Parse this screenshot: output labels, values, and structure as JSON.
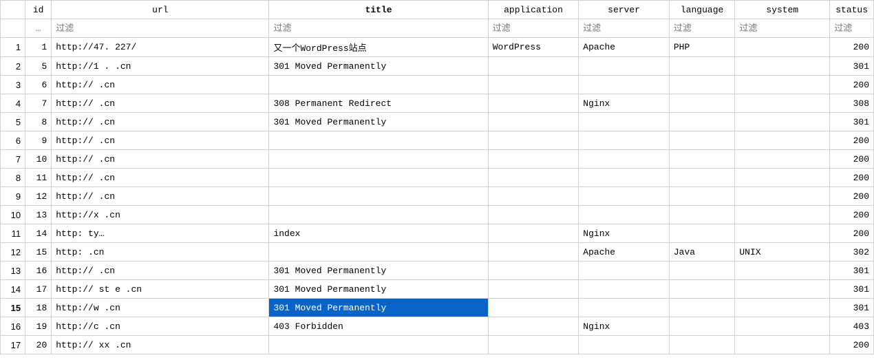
{
  "columns": {
    "id": "id",
    "url": "url",
    "title": "title",
    "application": "application",
    "server": "server",
    "language": "language",
    "system": "system",
    "status": "status"
  },
  "filter": {
    "placeholder": "过滤",
    "more": "…"
  },
  "selected_row_index": 14,
  "selected_column": "title",
  "rows": [
    {
      "rownum": "1",
      "id": "1",
      "url": "http://47.     227/",
      "title": "又一个WordPress站点",
      "application": "WordPress",
      "server": "Apache",
      "language": "PHP",
      "system": "",
      "status": "200"
    },
    {
      "rownum": "2",
      "id": "5",
      "url": "http://1  .        .cn",
      "title": "301 Moved Permanently",
      "application": "",
      "server": "",
      "language": "",
      "system": "",
      "status": "301"
    },
    {
      "rownum": "3",
      "id": "6",
      "url": "http://            .cn",
      "title": "",
      "application": "",
      "server": "",
      "language": "",
      "system": "",
      "status": "200"
    },
    {
      "rownum": "4",
      "id": "7",
      "url": "http://               .cn",
      "title": "308 Permanent Redirect",
      "application": "",
      "server": "Nginx",
      "language": "",
      "system": "",
      "status": "308"
    },
    {
      "rownum": "5",
      "id": "8",
      "url": "http://            .cn",
      "title": "301 Moved Permanently",
      "application": "",
      "server": "",
      "language": "",
      "system": "",
      "status": "301"
    },
    {
      "rownum": "6",
      "id": "9",
      "url": "http://            .cn",
      "title": "",
      "application": "",
      "server": "",
      "language": "",
      "system": "",
      "status": "200"
    },
    {
      "rownum": "7",
      "id": "10",
      "url": "http://               .cn",
      "title": "",
      "application": "",
      "server": "",
      "language": "",
      "system": "",
      "status": "200"
    },
    {
      "rownum": "8",
      "id": "11",
      "url": "http://            .cn",
      "title": "",
      "application": "",
      "server": "",
      "language": "",
      "system": "",
      "status": "200"
    },
    {
      "rownum": "9",
      "id": "12",
      "url": "http://            .cn",
      "title": "",
      "application": "",
      "server": "",
      "language": "",
      "system": "",
      "status": "200"
    },
    {
      "rownum": "10",
      "id": "13",
      "url": "http://x           .cn",
      "title": "",
      "application": "",
      "server": "",
      "language": "",
      "system": "",
      "status": "200"
    },
    {
      "rownum": "11",
      "id": "14",
      "url": "http:               ty…",
      "title": "index",
      "application": "",
      "server": "Nginx",
      "language": "",
      "system": "",
      "status": "200"
    },
    {
      "rownum": "12",
      "id": "15",
      "url": "http:              .cn",
      "title": "",
      "application": "",
      "server": "Apache",
      "language": "Java",
      "system": "UNIX",
      "status": "302"
    },
    {
      "rownum": "13",
      "id": "16",
      "url": "http://            .cn",
      "title": "301 Moved Permanently",
      "application": "",
      "server": "",
      "language": "",
      "system": "",
      "status": "301"
    },
    {
      "rownum": "14",
      "id": "17",
      "url": "http://    st  e   .cn",
      "title": "301 Moved Permanently",
      "application": "",
      "server": "",
      "language": "",
      "system": "",
      "status": "301"
    },
    {
      "rownum": "15",
      "id": "18",
      "url": "http://w           .cn",
      "title": "301 Moved Permanently",
      "application": "",
      "server": "",
      "language": "",
      "system": "",
      "status": "301"
    },
    {
      "rownum": "16",
      "id": "19",
      "url": "http://c           .cn",
      "title": "403 Forbidden",
      "application": "",
      "server": "Nginx",
      "language": "",
      "system": "",
      "status": "403"
    },
    {
      "rownum": "17",
      "id": "20",
      "url": "http://  xx        .cn",
      "title": "",
      "application": "",
      "server": "",
      "language": "",
      "system": "",
      "status": "200"
    }
  ]
}
